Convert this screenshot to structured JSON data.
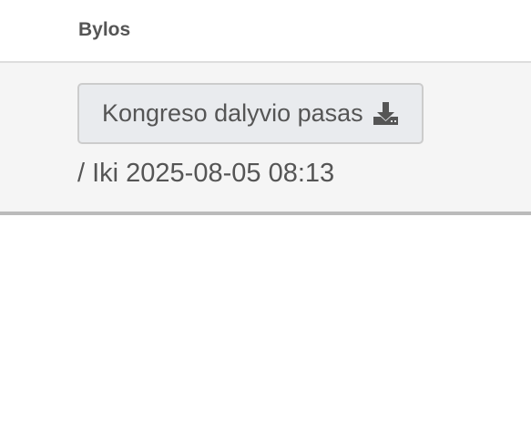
{
  "files": {
    "header_label": "Bylos",
    "download_button": {
      "label": "Kongreso dalyvio pasas",
      "icon": "download-icon"
    },
    "expiry_text": "/ Iki 2025-08-05 08:13"
  },
  "colors": {
    "text": "#555555",
    "row_background": "#f5f5f5",
    "button_background": "#e9ebee",
    "button_border": "#cccccc",
    "header_divider": "#dddddd",
    "row_divider": "#bbbbbb"
  }
}
